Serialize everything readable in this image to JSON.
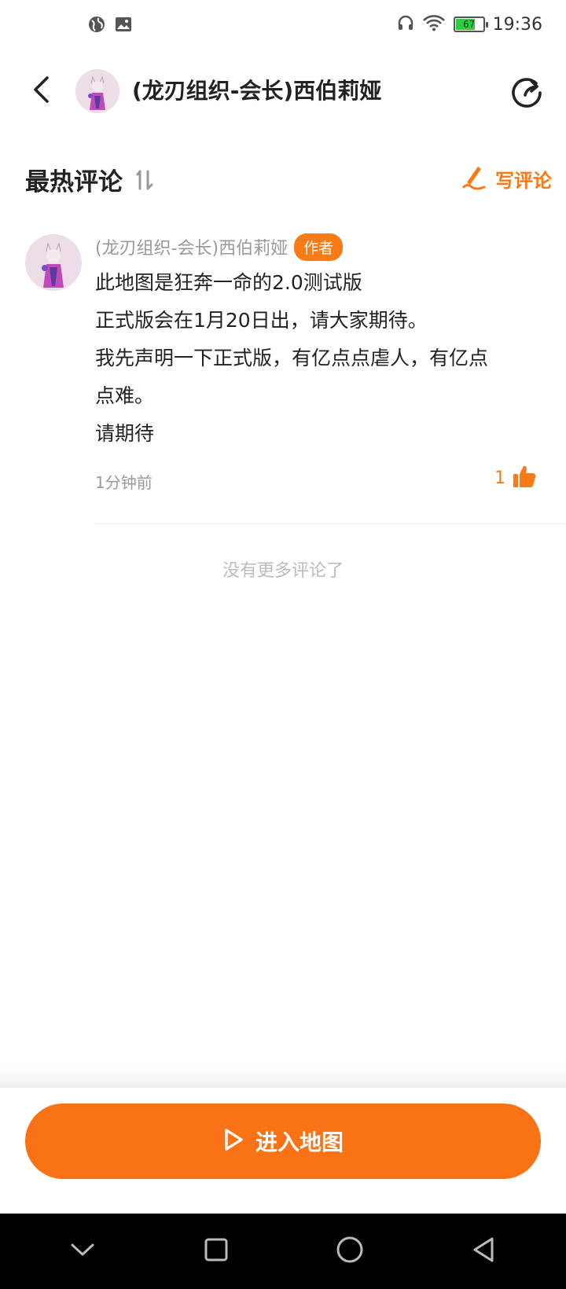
{
  "status_bar": {
    "time": "19:36",
    "battery_level": "67",
    "icons": [
      "globe-icon",
      "image-icon",
      "headset-icon",
      "wifi-icon",
      "battery-icon"
    ]
  },
  "header": {
    "title": "(龙刃组织-会长)西伯莉娅",
    "back_icon": "chevron-left-icon",
    "share_icon": "share-icon"
  },
  "section": {
    "title": "最热评论",
    "sort_icon": "sort-icon",
    "write_label": "写评论",
    "write_icon": "pen-icon"
  },
  "comment": {
    "author": "(龙刃组织-会长)西伯莉娅",
    "badge": "作者",
    "lines": [
      "此地图是狂奔一命的2.0测试版",
      "正式版会在1月20日出，请大家期待。",
      "我先声明一下正式版，有亿点点虐人，有亿点",
      "点难。",
      "请期待"
    ],
    "time": "1分钟前",
    "like_count": "1",
    "like_icon": "thumbs-up-icon"
  },
  "no_more_text": "没有更多评论了",
  "bottom": {
    "enter_label": "进入地图",
    "enter_icon": "play-icon"
  },
  "nav_bar": {
    "icons": [
      "chevron-down-icon",
      "square-icon",
      "circle-icon",
      "triangle-back-icon"
    ]
  },
  "colors": {
    "accent": "#fa7216",
    "text_primary": "#222222",
    "text_secondary": "#999999"
  }
}
